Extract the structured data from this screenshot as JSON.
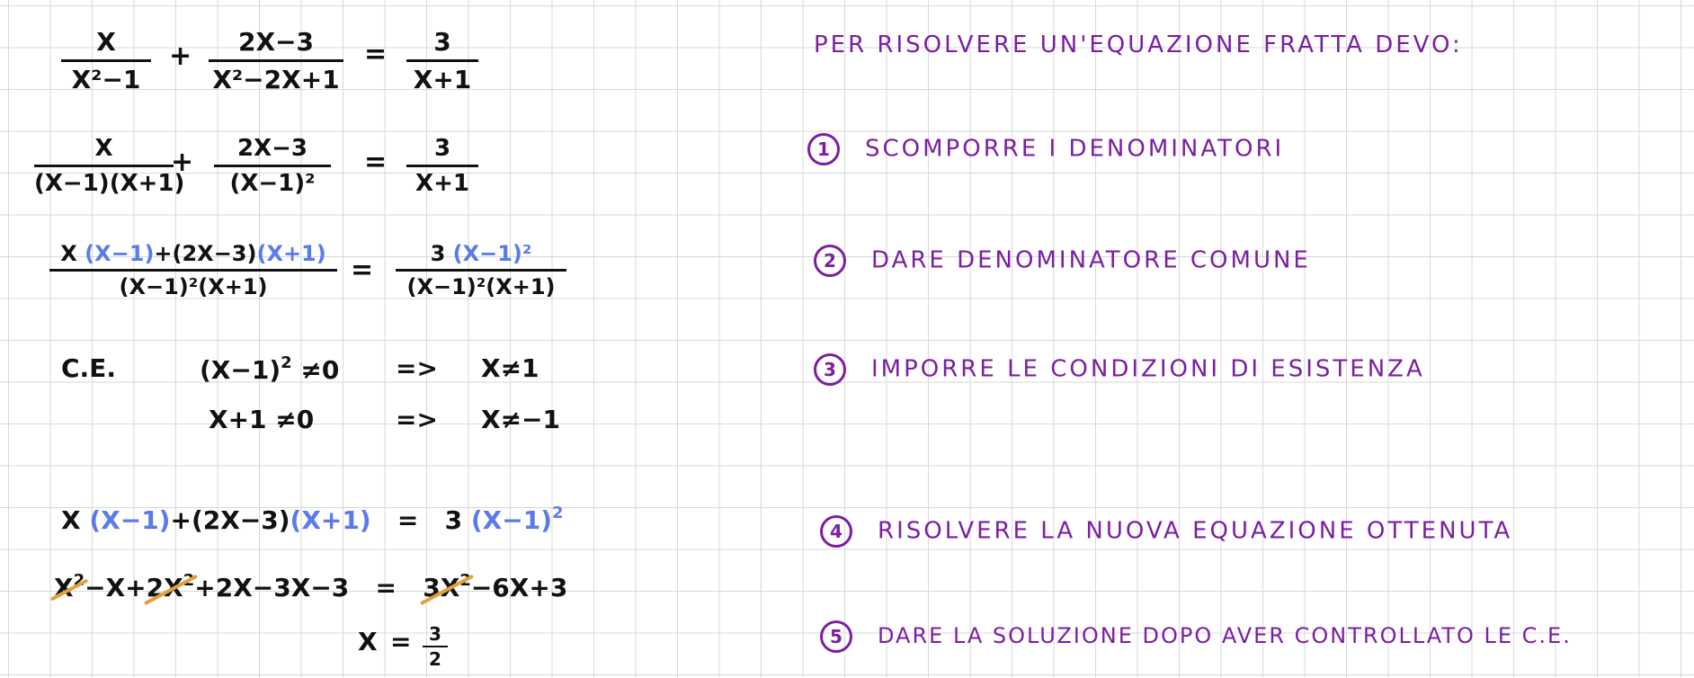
{
  "equation1": {
    "frac1": {
      "num": "X",
      "den": "X²−1"
    },
    "plus": "+",
    "frac2": {
      "num": "2X−3",
      "den": "X²−2X+1"
    },
    "equals": "=",
    "frac3": {
      "num": "3",
      "den": "X+1"
    }
  },
  "equation2": {
    "frac1": {
      "num": "X",
      "den": "(X−1)(X+1)"
    },
    "plus": "+",
    "frac2": {
      "num": "2X−3",
      "den": "(X−1)²"
    },
    "equals": "=",
    "frac3": {
      "num": "3",
      "den": "X+1"
    }
  },
  "equation3": {
    "lhs_num": {
      "x": "X",
      "f1": "(X−1)",
      "plus": "+",
      "f2": "(2X−3)",
      "f3": "(X+1)"
    },
    "lhs_den": "(X−1)²(X+1)",
    "equals": "=",
    "rhs_num": {
      "c": "3",
      "f": "(X−1)²"
    },
    "rhs_den": "(X−1)²(X+1)"
  },
  "conditions": {
    "label": "C.E.",
    "c1": {
      "lhs": "(X−1)",
      "exp": "2",
      "neq": "≠0",
      "implies": "=>",
      "result": "X≠1"
    },
    "c2": {
      "lhs": "X+1",
      "neq": "≠0",
      "implies": "=>",
      "result": "X≠−1"
    }
  },
  "equation4": {
    "x": "X",
    "f1": "(X−1)",
    "plus": "+",
    "f2": "(2X−3)",
    "f3": "(X+1)",
    "equals": "=",
    "c": "3",
    "f4": "(X−1)",
    "exp": "2"
  },
  "equation5": {
    "t1": "X",
    "t1exp": "2",
    "t2": "−X+",
    "t3": "2X",
    "t3exp": "2",
    "t4": "+2X−3X−3",
    "equals": "=",
    "t5": "3X",
    "t5exp": "2",
    "t6": "−6X+3"
  },
  "solution": {
    "lhs": "X",
    "equals": "=",
    "num": "3",
    "den": "2"
  },
  "notes": {
    "heading": "PER RISOLVERE UN'EQUAZIONE FRATTA DEVO:",
    "steps": [
      {
        "n": "1",
        "text": "SCOMPORRE I DENOMINATORI"
      },
      {
        "n": "2",
        "text": "DARE DENOMINATORE COMUNE"
      },
      {
        "n": "3",
        "text": "IMPORRE LE CONDIZIONI DI ESISTENZA"
      },
      {
        "n": "4",
        "text": "RISOLVERE LA NUOVA EQUAZIONE OTTENUTA"
      },
      {
        "n": "5",
        "text": "DARE LA SOLUZIONE DOPO AVER CONTROLLATO LE C.E."
      }
    ],
    "accent_color": "#7b1fa2",
    "highlight_color": "#5b7bea",
    "strike_color": "#e2a13a"
  }
}
